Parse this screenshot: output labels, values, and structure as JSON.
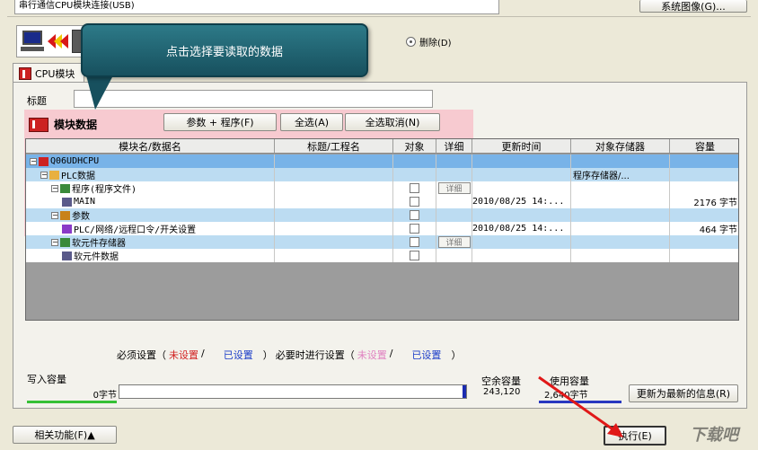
{
  "connection": {
    "text": "串行通信CPU模块连接(USB)",
    "system_image_button": "系统图像(G)..."
  },
  "radio": {
    "delete_label": "删除(D)"
  },
  "tooltip": {
    "text": "点击选择要读取的数据"
  },
  "tab": {
    "label": "CPU模块"
  },
  "title_field": {
    "label": "标题",
    "value": ""
  },
  "module": {
    "label": "模块数据",
    "buttons": {
      "param_program": "参数 + 程序(F)",
      "select_all": "全选(A)",
      "deselect_all": "全选取消(N)"
    }
  },
  "table": {
    "headers": [
      "模块名/数据名",
      "标题/工程名",
      "对象",
      "详细",
      "更新时间",
      "对象存储器",
      "容量"
    ],
    "rows": [
      {
        "name": "Q06UDHCPU",
        "title": "",
        "update": "",
        "memory": "",
        "capacity": "",
        "checkbox": false,
        "detail": false,
        "color": "#78b3e8",
        "indent": 0,
        "expander": "−",
        "icon": "plc"
      },
      {
        "name": "PLC数据",
        "title": "",
        "update": "",
        "memory": "程序存储器/...",
        "capacity": "",
        "checkbox": false,
        "detail": false,
        "color": "#bcdcf2",
        "indent": 1,
        "expander": "−",
        "icon": "folder"
      },
      {
        "name": "程序(程序文件)",
        "title": "",
        "update": "",
        "memory": "",
        "capacity": "",
        "checkbox": true,
        "detail": true,
        "color": "#ffffff",
        "indent": 2,
        "expander": "−",
        "icon": "prog"
      },
      {
        "name": "MAIN",
        "title": "",
        "update": "2010/08/25 14:...",
        "memory": "",
        "capacity": "2176 字节",
        "checkbox": true,
        "detail": false,
        "color": "#ffffff",
        "indent": 3,
        "expander": "",
        "icon": "file"
      },
      {
        "name": "参数",
        "title": "",
        "update": "",
        "memory": "",
        "capacity": "",
        "checkbox": true,
        "detail": false,
        "color": "#bcdcf2",
        "indent": 2,
        "expander": "−",
        "icon": "param"
      },
      {
        "name": "PLC/网络/远程口令/开关设置",
        "title": "",
        "update": "2010/08/25 14:...",
        "memory": "",
        "capacity": "464 字节",
        "checkbox": true,
        "detail": false,
        "color": "#ffffff",
        "indent": 3,
        "expander": "",
        "icon": "gear"
      },
      {
        "name": "软元件存储器",
        "title": "",
        "update": "",
        "memory": "",
        "capacity": "",
        "checkbox": true,
        "detail": true,
        "color": "#bcdcf2",
        "indent": 2,
        "expander": "−",
        "icon": "prog"
      },
      {
        "name": "软元件数据",
        "title": "",
        "update": "",
        "memory": "",
        "capacity": "",
        "checkbox": true,
        "detail": false,
        "color": "#ffffff",
        "indent": 3,
        "expander": "",
        "icon": "file"
      }
    ],
    "detail_label": "详细"
  },
  "legend": {
    "required": "必须设置（",
    "unset": "未设置",
    "slash1": "/",
    "set": "已设置",
    "close1": "）",
    "optional": "必要时进行设置（",
    "unset2": "未设置",
    "slash2": "/",
    "set2": "已设置",
    "close2": "）",
    "unset_color": "#d22020",
    "set_color": "#1a3cc8",
    "unset2_color": "#e080c0"
  },
  "capacity": {
    "write_label": "写入容量",
    "write_value": "0字节",
    "free_label": "空余容量",
    "free_value": "243,120",
    "used_label": "使用容量",
    "used_value": "2,640字节",
    "update_button": "更新为最新的信息(R)"
  },
  "footer": {
    "related": "相关功能(F)▲",
    "execute": "执行(E)"
  },
  "watermark": "下载吧"
}
